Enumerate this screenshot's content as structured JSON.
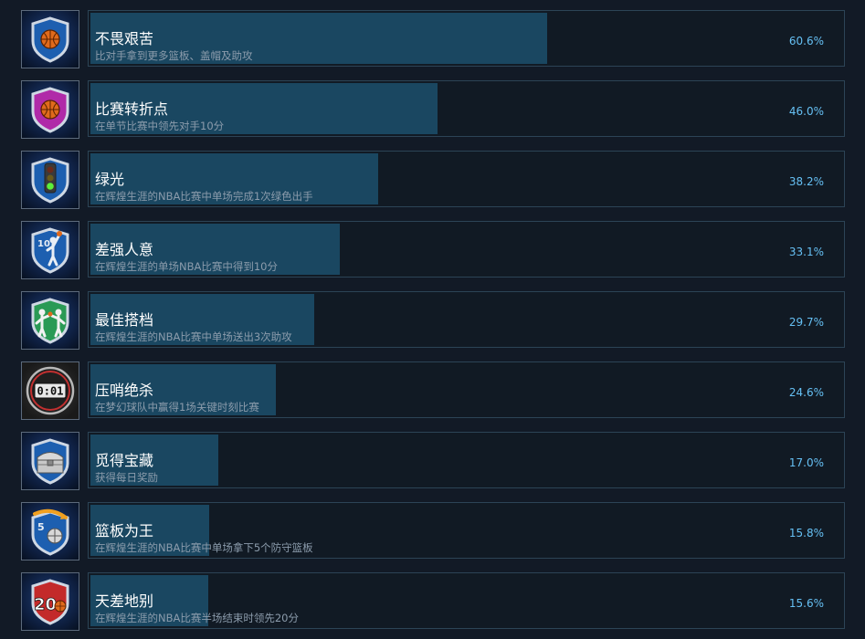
{
  "achievements": [
    {
      "title": "不畏艰苦",
      "desc": "比对手拿到更多篮板、盖帽及助攻",
      "percent_label": "60.6%",
      "percent": 60.6,
      "icon": "basketball-shield-blue-icon"
    },
    {
      "title": "比赛转折点",
      "desc": "在单节比赛中领先对手10分",
      "percent_label": "46.0%",
      "percent": 46.0,
      "icon": "basketball-shield-purple-icon"
    },
    {
      "title": "绿光",
      "desc": "在辉煌生涯的NBA比赛中单场完成1次绿色出手",
      "percent_label": "38.2%",
      "percent": 38.2,
      "icon": "traffic-light-icon"
    },
    {
      "title": "差强人意",
      "desc": "在辉煌生涯的单场NBA比赛中得到10分",
      "percent_label": "33.1%",
      "percent": 33.1,
      "icon": "player-shooting-icon"
    },
    {
      "title": "最佳搭档",
      "desc": "在辉煌生涯的NBA比赛中单场送出3次助攻",
      "percent_label": "29.7%",
      "percent": 29.7,
      "icon": "assist-players-icon"
    },
    {
      "title": "压哨绝杀",
      "desc": "在梦幻球队中赢得1场关键时刻比赛",
      "percent_label": "24.6%",
      "percent": 24.6,
      "icon": "shot-clock-icon",
      "clock_text": "0:01"
    },
    {
      "title": "觅得宝藏",
      "desc": "获得每日奖励",
      "percent_label": "17.0%",
      "percent": 17.0,
      "icon": "treasure-chest-icon"
    },
    {
      "title": "篮板为王",
      "desc": "在辉煌生涯的NBA比赛中单场拿下5个防守篮板",
      "percent_label": "15.8%",
      "percent": 15.8,
      "icon": "rebound-shield-icon",
      "badge_text": "5"
    },
    {
      "title": "天差地别",
      "desc": "在辉煌生涯的NBA比赛半场结束时领先20分",
      "percent_label": "15.6%",
      "percent": 15.6,
      "icon": "lead-twenty-icon",
      "badge_text": "20"
    }
  ],
  "colors": {
    "background": "#121a26",
    "bar_fill": "#1a4761",
    "percent_text": "#66c0f4",
    "title_text": "#ffffff",
    "desc_text": "#8c9cac"
  }
}
